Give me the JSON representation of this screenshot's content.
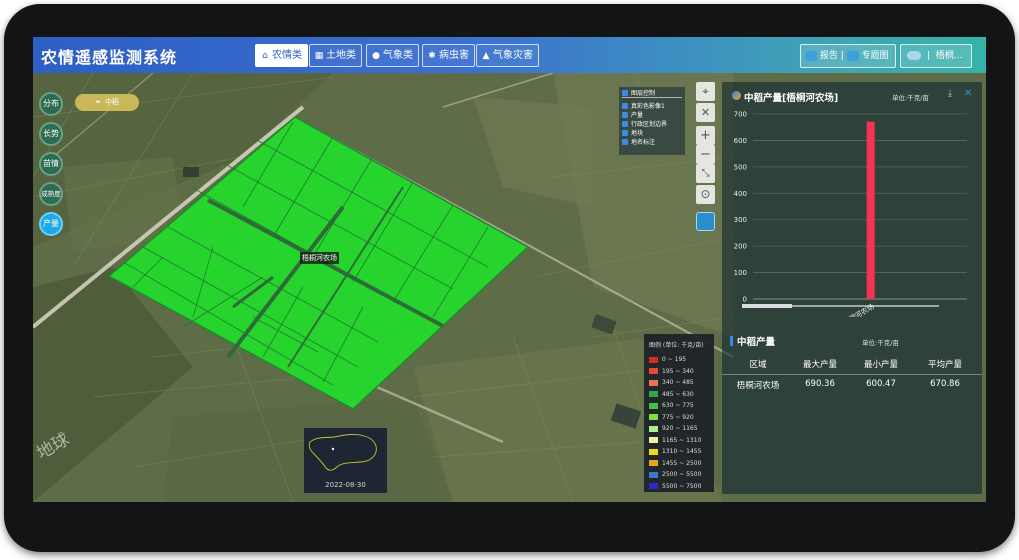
{
  "app": {
    "title": "农情遥感监测系统"
  },
  "nav": {
    "tabs": [
      {
        "label": "农情类",
        "icon": "house-icon",
        "icon_glyph": "⌂"
      },
      {
        "label": "土地类",
        "icon": "grid-icon",
        "icon_glyph": "▦"
      },
      {
        "label": "气象类",
        "icon": "droplet-icon",
        "icon_glyph": "●"
      },
      {
        "label": "病虫害",
        "icon": "bug-icon",
        "icon_glyph": "✱"
      },
      {
        "label": "气象灾害",
        "icon": "warning-icon",
        "icon_glyph": "▲"
      }
    ],
    "active_tab": 0
  },
  "toolbar": {
    "report_label": "报告",
    "separator": "|",
    "thematic_label": "专题图",
    "location_label": "梧桐...",
    "location_separator": "|"
  },
  "sidebar": {
    "items": [
      {
        "label": "分布"
      },
      {
        "label": "长势"
      },
      {
        "label": "苗情"
      },
      {
        "label": "成熟度"
      },
      {
        "label": "产量"
      }
    ],
    "active_item": 4
  },
  "crop_pill": {
    "label": "中稻"
  },
  "layer_control": {
    "title": "图层控制",
    "items": [
      "真彩色影像1",
      "产量",
      "行政区划边界",
      "地块",
      "地名标注"
    ]
  },
  "map": {
    "farm_label": "梧桐河农场",
    "watermark": "地球"
  },
  "legend": {
    "title": "图例 (单位: 千克/亩)",
    "items": [
      {
        "label": "0 ~ 195",
        "color": "#d62a2a"
      },
      {
        "label": "195 ~ 340",
        "color": "#e84a3a"
      },
      {
        "label": "340 ~ 485",
        "color": "#e8755a"
      },
      {
        "label": "485 ~ 630",
        "color": "#2fa84a"
      },
      {
        "label": "630 ~ 775",
        "color": "#3ec43e"
      },
      {
        "label": "775 ~ 920",
        "color": "#7fe03a"
      },
      {
        "label": "920 ~ 1165",
        "color": "#a8f090"
      },
      {
        "label": "1165 ~ 1310",
        "color": "#f0f0a8"
      },
      {
        "label": "1310 ~ 1455",
        "color": "#e8d820"
      },
      {
        "label": "1455 ~ 2500",
        "color": "#e0a820"
      },
      {
        "label": "2500 ~ 5500",
        "color": "#3a78d0"
      },
      {
        "label": "5500 ~ 7500",
        "color": "#2a2ac8"
      }
    ]
  },
  "minimap": {
    "date": "2022-08-30"
  },
  "chart_panel": {
    "title": "中稻产量[梧桐河农场]",
    "unit": "单位:千克/亩",
    "download_icon": "download-icon",
    "close_icon": "close-icon"
  },
  "chart_data": {
    "type": "bar",
    "categories": [
      "梧桐河农场"
    ],
    "values": [
      670.86
    ],
    "ylim": [
      0,
      700
    ],
    "yticks": [
      0,
      100,
      200,
      300,
      400,
      500,
      600,
      700
    ],
    "bar_color": "#f23552",
    "grid": true
  },
  "table_panel": {
    "title": "中稻产量",
    "unit": "单位:千克/亩",
    "columns": [
      "区域",
      "最大产量",
      "最小产量",
      "平均产量"
    ],
    "rows": [
      [
        "梧桐河农场",
        "690.36",
        "600.47",
        "670.86"
      ]
    ]
  },
  "colors": {
    "header_start": "#2d5fc4",
    "header_end": "#37b3a8",
    "field_green": "#27d42d",
    "active_side": "#1ea8e6",
    "bar": "#f23552"
  }
}
